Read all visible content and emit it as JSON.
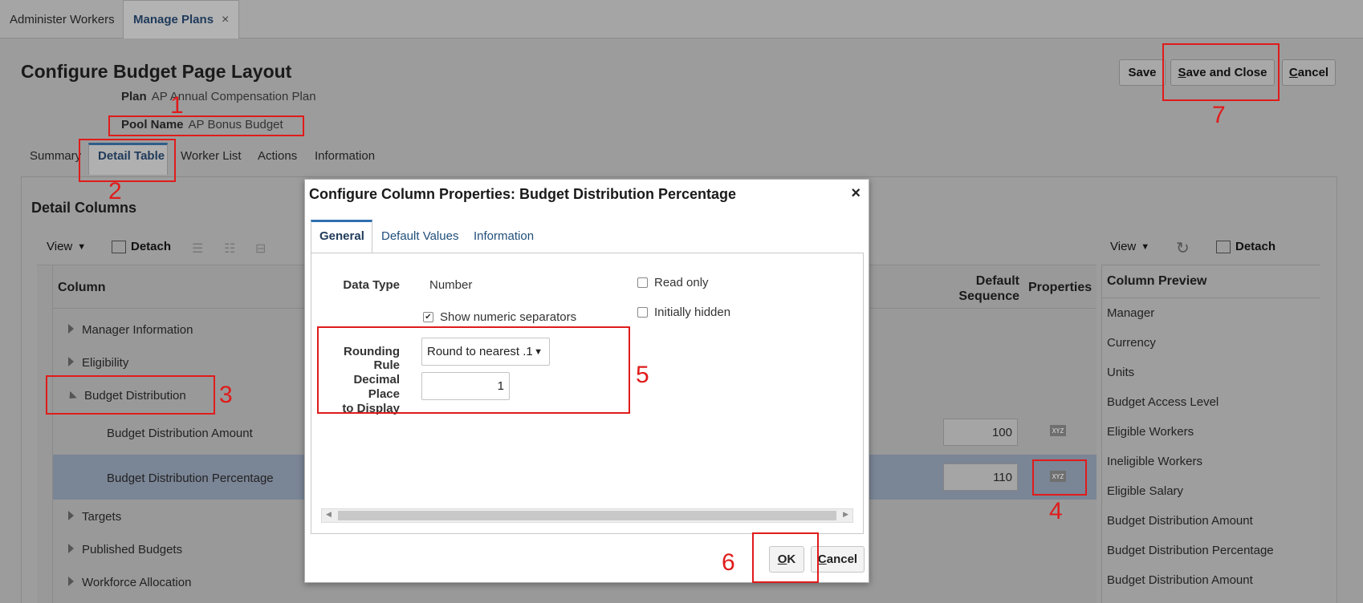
{
  "top_tabs": [
    {
      "label": "Administer Workers"
    },
    {
      "label": "Manage Plans",
      "close": "×"
    }
  ],
  "page": {
    "title": "Configure Budget Page Layout",
    "plan_label": "Plan",
    "plan_value": "AP Annual Compensation Plan",
    "pool_label": "Pool Name",
    "pool_value": "AP Bonus Budget",
    "buttons": {
      "save": "Save",
      "save_close_pre": "",
      "save_close_key": "S",
      "save_close_rest": "ave and Close",
      "cancel_key": "C",
      "cancel_rest": "ancel"
    }
  },
  "sub_tabs": [
    "Summary",
    "Detail Table",
    "Worker List",
    "Actions",
    "Information"
  ],
  "detail": {
    "section_title": "Detail Columns",
    "toolbar_left": {
      "view": "View",
      "detach": "Detach"
    },
    "toolbar_right": {
      "view": "View",
      "detach": "Detach"
    },
    "col_header": "Column",
    "col_default_seq_1": "Default",
    "col_default_seq_2": "Sequence",
    "col_properties": "Properties",
    "rows": [
      {
        "label": "Manager Information"
      },
      {
        "label": "Eligibility"
      },
      {
        "label": "Budget Distribution"
      },
      {
        "label": "Budget Distribution Amount",
        "seq": "100",
        "icon": "XYZ"
      },
      {
        "label": "Budget Distribution Percentage",
        "seq": "110",
        "icon": "XYZ"
      },
      {
        "label": "Targets"
      },
      {
        "label": "Published Budgets"
      },
      {
        "label": "Workforce Allocation"
      }
    ],
    "preview_header": "Column Preview",
    "preview_items": [
      "Manager",
      "Currency",
      "Units",
      "Budget Access Level",
      "Eligible Workers",
      "Ineligible Workers",
      "Eligible Salary",
      "Budget Distribution Amount",
      "Budget Distribution Percentage",
      "Budget Distribution Amount"
    ]
  },
  "dialog": {
    "title": "Configure Column Properties: Budget Distribution Percentage",
    "close": "×",
    "tabs": [
      "General",
      "Default Values",
      "Information"
    ],
    "data_type_label": "Data Type",
    "data_type_value": "Number",
    "show_separators": "Show numeric separators",
    "read_only": "Read only",
    "initially_hidden": "Initially hidden",
    "rounding_label": "Rounding Rule",
    "rounding_value": "Round to nearest .1",
    "decimal_label_1": "Decimal Place",
    "decimal_label_2": "to Display",
    "decimal_value": "1",
    "ok_key": "O",
    "ok_rest": "K",
    "cancel_key": "C",
    "cancel_rest": "ancel"
  },
  "annotations": [
    "1",
    "2",
    "3",
    "4",
    "5",
    "6",
    "7"
  ],
  "colors": {
    "annotation": "#e01b1b",
    "link": "#1f4e79"
  }
}
